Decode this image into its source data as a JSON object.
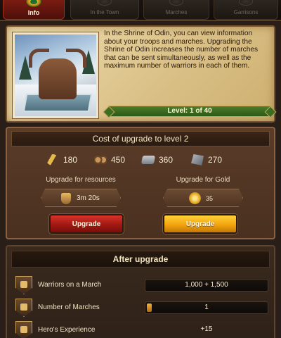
{
  "tabs": [
    {
      "label": "Info",
      "active": true
    },
    {
      "label": "In the Town",
      "active": false
    },
    {
      "label": "Marches",
      "active": false
    },
    {
      "label": "Garrisons",
      "active": false
    }
  ],
  "building": {
    "name": "Shrine of Odin",
    "description": "In the Shrine of Odin, you can view information about your troops and marches. Upgrading the Shrine of Odin increases the number of marches that can be sent simultaneously, as well as the maximum number of warriors in each of them.",
    "level_text": "Level: 1 of 40",
    "level": 1,
    "max_level": 40
  },
  "cost": {
    "title": "Cost of upgrade to level 2",
    "resources": [
      {
        "icon": "wheat-icon",
        "value": "180"
      },
      {
        "icon": "wood-icon",
        "value": "450"
      },
      {
        "icon": "stone-icon",
        "value": "360"
      },
      {
        "icon": "iron-icon",
        "value": "270"
      }
    ],
    "resources_option": {
      "label": "Upgrade for resources",
      "time": "3m 20s",
      "button": "Upgrade"
    },
    "gold_option": {
      "label": "Upgrade for Gold",
      "price": "35",
      "button": "Upgrade"
    }
  },
  "after_upgrade": {
    "title": "After upgrade",
    "stats": [
      {
        "label": "Warriors on a March",
        "value": "1,000 + 1,500"
      },
      {
        "label": "Number of Marches",
        "value": "1"
      },
      {
        "label": "Hero's Experience",
        "value": "+15"
      }
    ]
  },
  "colors": {
    "active_tab": "#7a1c12",
    "level_banner": "#3d6d20",
    "upgrade_red": "#a01812",
    "upgrade_gold": "#f3a40e"
  }
}
